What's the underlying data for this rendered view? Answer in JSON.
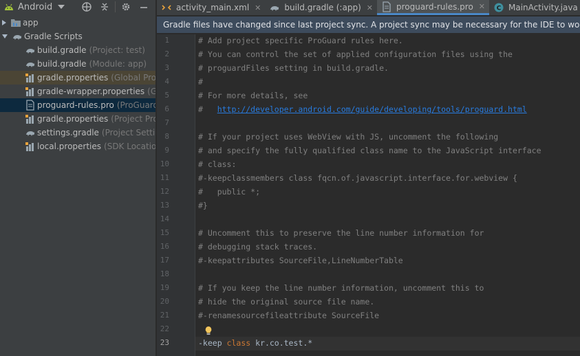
{
  "project_view": {
    "selector_label": "Android",
    "icons": [
      "add-icon",
      "collapse-icon",
      "gear-icon",
      "minimize-icon"
    ]
  },
  "tree": [
    {
      "name": "app",
      "hint": "",
      "icon": "folder-module-icon",
      "arrow": "right",
      "indent": 0
    },
    {
      "name": "Gradle Scripts",
      "hint": "",
      "icon": "gradle-icon",
      "arrow": "down",
      "indent": 0
    },
    {
      "name": "build.gradle",
      "hint": "(Project: test)",
      "icon": "gradle-icon",
      "arrow": "",
      "indent": 1
    },
    {
      "name": "build.gradle",
      "hint": "(Module: app)",
      "icon": "gradle-icon",
      "arrow": "",
      "indent": 1
    },
    {
      "name": "gradle.properties",
      "hint": "(Global Properties)",
      "icon": "properties-icon",
      "arrow": "",
      "indent": 1,
      "state": "warn"
    },
    {
      "name": "gradle-wrapper.properties",
      "hint": "(Gradle Version)",
      "icon": "properties-icon",
      "arrow": "",
      "indent": 1
    },
    {
      "name": "proguard-rules.pro",
      "hint": "(ProGuard Rules for app)",
      "icon": "file-icon",
      "arrow": "",
      "indent": 1,
      "state": "selected"
    },
    {
      "name": "gradle.properties",
      "hint": "(Project Properties)",
      "icon": "properties-icon",
      "arrow": "",
      "indent": 1
    },
    {
      "name": "settings.gradle",
      "hint": "(Project Settings)",
      "icon": "gradle-icon",
      "arrow": "",
      "indent": 1
    },
    {
      "name": "local.properties",
      "hint": "(SDK Location)",
      "icon": "properties-icon",
      "arrow": "",
      "indent": 1
    }
  ],
  "tabs": [
    {
      "label": "activity_main.xml",
      "icon": "xml-file-icon",
      "active": false
    },
    {
      "label": "build.gradle (:app)",
      "icon": "gradle-icon",
      "active": false
    },
    {
      "label": "proguard-rules.pro",
      "icon": "file-icon",
      "active": true
    },
    {
      "label": "MainActivity.java",
      "icon": "java-class-icon",
      "active": false
    }
  ],
  "banner": "Gradle files have changed since last project sync. A project sync may be necessary for the IDE to work properly.",
  "editor": {
    "current_line": 23,
    "lines": [
      "# Add project specific ProGuard rules here.",
      "# You can control the set of applied configuration files using the",
      "# proguardFiles setting in build.gradle.",
      "#",
      "# For more details, see",
      "#   http://developer.android.com/guide/developing/tools/proguard.html",
      "",
      "# If your project uses WebView with JS, uncomment the following",
      "# and specify the fully qualified class name to the JavaScript interface",
      "# class:",
      "#-keepclassmembers class fqcn.of.javascript.interface.for.webview {",
      "#   public *;",
      "#}",
      "",
      "# Uncomment this to preserve the line number information for",
      "# debugging stack traces.",
      "#-keepattributes SourceFile,LineNumberTable",
      "",
      "# If you keep the line number information, uncomment this to",
      "# hide the original source file name.",
      "#-renamesourcefileattribute SourceFile",
      "",
      "-keep class kr.co.test.*"
    ],
    "link": "http://developer.android.com/guide/developing/tools/proguard.html"
  },
  "colors": {
    "accent": "#4a88c7",
    "keyword": "#cc7832",
    "comment": "#808080",
    "link": "#287bde",
    "banner_bg": "#3d4b5c"
  }
}
